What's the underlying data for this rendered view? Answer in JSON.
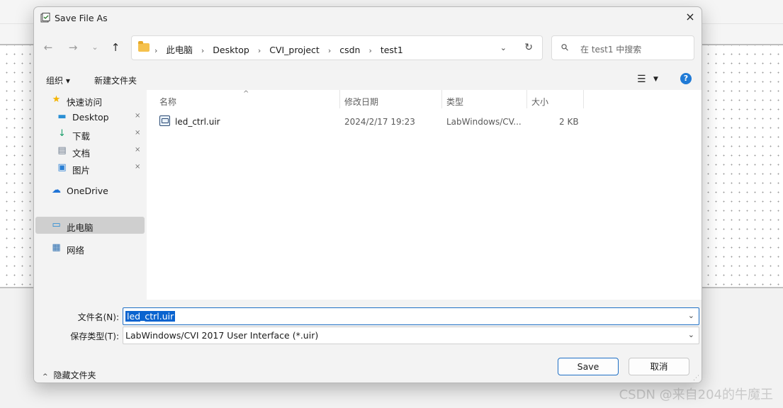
{
  "dialog": {
    "title": "Save File As",
    "close_icon": "×"
  },
  "nav": {
    "back_icon": "←",
    "forward_icon": "→",
    "recent_icon": "⌄",
    "up_icon": "↑",
    "breadcrumbs": [
      "此电脑",
      "Desktop",
      "CVI_project",
      "csdn",
      "test1"
    ],
    "separator": "›",
    "dropdown_icon": "⌄",
    "refresh_icon": "↻",
    "search_placeholder": "在 test1 中搜索",
    "search_icon": "⚲"
  },
  "cmdbar": {
    "organize": "组织 ▾",
    "new_folder": "新建文件夹",
    "view_icon": "☰",
    "view_caret": "▼",
    "help_icon": "?"
  },
  "sidebar": {
    "items": [
      {
        "label": "快速访问",
        "icon": "star-icon",
        "glyph": "★",
        "color": "#f4b400",
        "pinned": false
      },
      {
        "label": "Desktop",
        "icon": "desktop-icon",
        "glyph": "▬",
        "color": "#2a8fd4",
        "pinned": true
      },
      {
        "label": "下载",
        "icon": "download-icon",
        "glyph": "↓",
        "color": "#1a9e6a",
        "pinned": true
      },
      {
        "label": "文档",
        "icon": "document-icon",
        "glyph": "▤",
        "color": "#6b7a8c",
        "pinned": true
      },
      {
        "label": "图片",
        "icon": "pictures-icon",
        "glyph": "▣",
        "color": "#2a7fd4",
        "pinned": true
      },
      {
        "label": "OneDrive",
        "icon": "cloud-icon",
        "glyph": "☁",
        "color": "#1e73d6",
        "pinned": false
      },
      {
        "label": "此电脑",
        "icon": "computer-icon",
        "glyph": "▭",
        "color": "#1e88d6",
        "pinned": false,
        "selected": true
      },
      {
        "label": "网络",
        "icon": "network-icon",
        "glyph": "▦",
        "color": "#2d6fb0",
        "pinned": false
      }
    ],
    "pin_glyph": "📌"
  },
  "columns": {
    "name": "名称",
    "modified": "修改日期",
    "type": "类型",
    "size": "大小",
    "sort_glyph": "^"
  },
  "files": [
    {
      "name": "led_ctrl.uir",
      "modified": "2024/2/17 19:23",
      "type": "LabWindows/CV...",
      "size": "2 KB"
    }
  ],
  "form": {
    "filename_label": "文件名(N):",
    "filename_value": "led_ctrl.uir",
    "filetype_label": "保存类型(T):",
    "filetype_value": "LabWindows/CVI 2017 User Interface (*.uir)",
    "dropdown_icon": "⌄"
  },
  "footer": {
    "hide_folders": "隐藏文件夹",
    "hide_caret": "^",
    "save": "Save",
    "cancel": "取消"
  },
  "watermark": "CSDN @来自204的牛魔王",
  "colors": {
    "accent": "#1f6fc5",
    "selection": "#0a64cf"
  }
}
